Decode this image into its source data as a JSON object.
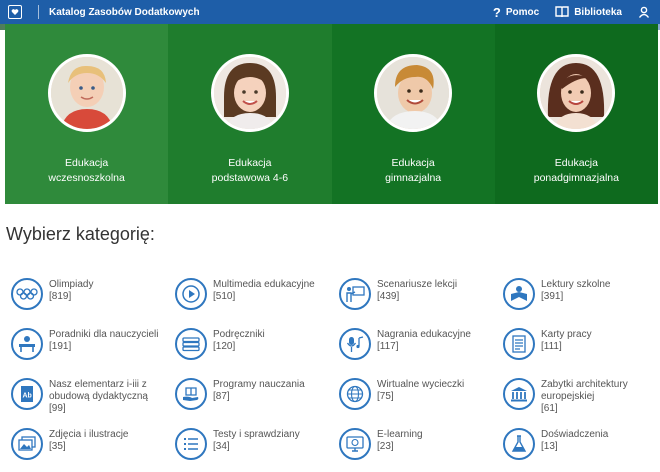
{
  "header": {
    "title": "Katalog Zasobów Dodatkowych",
    "help": "Pomoc",
    "library": "Biblioteka"
  },
  "colors": {
    "topbar": "#1e5ea8",
    "card1": "#2f8a3b",
    "card2": "#1f7d2d",
    "card3": "#137324",
    "card4": "#0e6a1e",
    "icon": "#2f77bf"
  },
  "hero": [
    {
      "line1": "Edukacja",
      "line2": "wczesnoszkolna"
    },
    {
      "line1": "Edukacja",
      "line2": "podstawowa 4-6"
    },
    {
      "line1": "Edukacja",
      "line2": "gimnazjalna"
    },
    {
      "line1": "Edukacja",
      "line2": "ponadgimnazjalna"
    }
  ],
  "heading": "Wybierz kategorię:",
  "categories": [
    {
      "name": "Olimpiady",
      "count": "[819]"
    },
    {
      "name": "Multimedia edukacyjne",
      "count": "[510]"
    },
    {
      "name": "Scenariusze lekcji",
      "count": "[439]"
    },
    {
      "name": "Lektury szkolne",
      "count": "[391]"
    },
    {
      "name": "Poradniki dla nauczycieli",
      "count": "[191]"
    },
    {
      "name": "Podręczniki",
      "count": "[120]"
    },
    {
      "name": "Nagrania edukacyjne",
      "count": "[117]"
    },
    {
      "name": "Karty pracy",
      "count": "[111]"
    },
    {
      "name": "Nasz elementarz i-iii z obudową dydaktyczną",
      "count": "[99]"
    },
    {
      "name": "Programy nauczania",
      "count": "[87]"
    },
    {
      "name": "Wirtualne wycieczki",
      "count": "[75]"
    },
    {
      "name": "Zabytki architektury europejskiej",
      "count": "[61]"
    },
    {
      "name": "Zdjęcia i ilustracje",
      "count": "[35]"
    },
    {
      "name": "Testy i sprawdziany",
      "count": "[34]"
    },
    {
      "name": "E-learning",
      "count": "[23]"
    },
    {
      "name": "Doświadczenia",
      "count": "[13]"
    }
  ]
}
